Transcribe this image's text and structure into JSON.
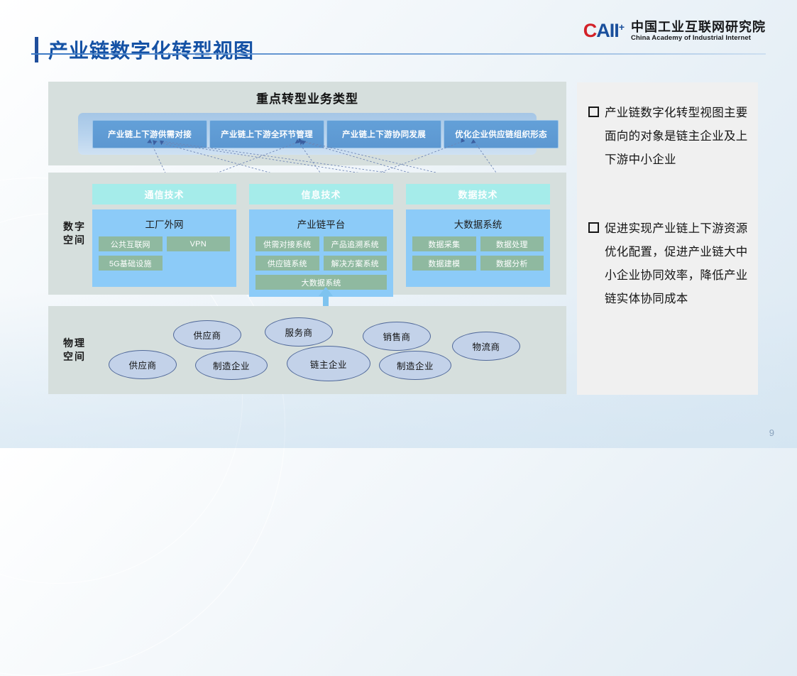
{
  "header": {
    "title": "产业链数字化转型视图",
    "logo": {
      "mark_c": "C",
      "mark_aii": "AII",
      "mark_plus": "+",
      "name_cn": "中国工业互联网研究院",
      "name_en": "China Academy of Industrial Internet"
    }
  },
  "business_section": {
    "heading": "重点转型业务类型",
    "boxes": [
      {
        "label": "产业链上下游供需对接"
      },
      {
        "label": "产业链上下游全环节管理"
      },
      {
        "label": "产业链上下游协同发展"
      },
      {
        "label": "优化企业供应链组织形态"
      }
    ]
  },
  "digital_space": {
    "label": "数字空间",
    "columns": [
      {
        "head": "通信技术",
        "title": "工厂外网",
        "chips": [
          {
            "label": "公共互联网"
          },
          {
            "label": "VPN"
          },
          {
            "label": "5G基础设施"
          }
        ]
      },
      {
        "head": "信息技术",
        "title": "产业链平台",
        "chips": [
          {
            "label": "供需对接系统"
          },
          {
            "label": "产品追溯系统"
          },
          {
            "label": "供应链系统"
          },
          {
            "label": "解决方案系统"
          },
          {
            "label": "大数据系统"
          }
        ]
      },
      {
        "head": "数据技术",
        "title": "大数据系统",
        "chips": [
          {
            "label": "数据采集"
          },
          {
            "label": "数据处理"
          },
          {
            "label": "数据建模"
          },
          {
            "label": "数据分析"
          }
        ]
      }
    ]
  },
  "physical_space": {
    "label": "物理空间",
    "nodes": [
      {
        "label": "供应商"
      },
      {
        "label": "服务商"
      },
      {
        "label": "销售商"
      },
      {
        "label": "物流商"
      },
      {
        "label": "供应商"
      },
      {
        "label": "制造企业"
      },
      {
        "label": "链主企业"
      },
      {
        "label": "制造企业"
      }
    ]
  },
  "notes": [
    {
      "text": "产业链数字化转型视图主要面向的对象是链主企业及上下游中小企业"
    },
    {
      "text": "促进实现产业链上下游资源优化配置，促进产业链大中小企业协同效率，降低产业链实体协同成本"
    }
  ],
  "footer": {
    "page_number": "9"
  },
  "colors": {
    "title_blue": "#1552a5",
    "brand_red": "#d32128",
    "brand_blue": "#1a4f9c",
    "panel_bg": "#d6dfdd",
    "biz_box": "#5c97d1",
    "tech_head": "#a5ecea",
    "tech_body": "#8ccbf8",
    "chip_green": "#8fb9a0",
    "ellipse_fill": "#c3d2e9",
    "notes_bg": "#f0f0f0"
  }
}
